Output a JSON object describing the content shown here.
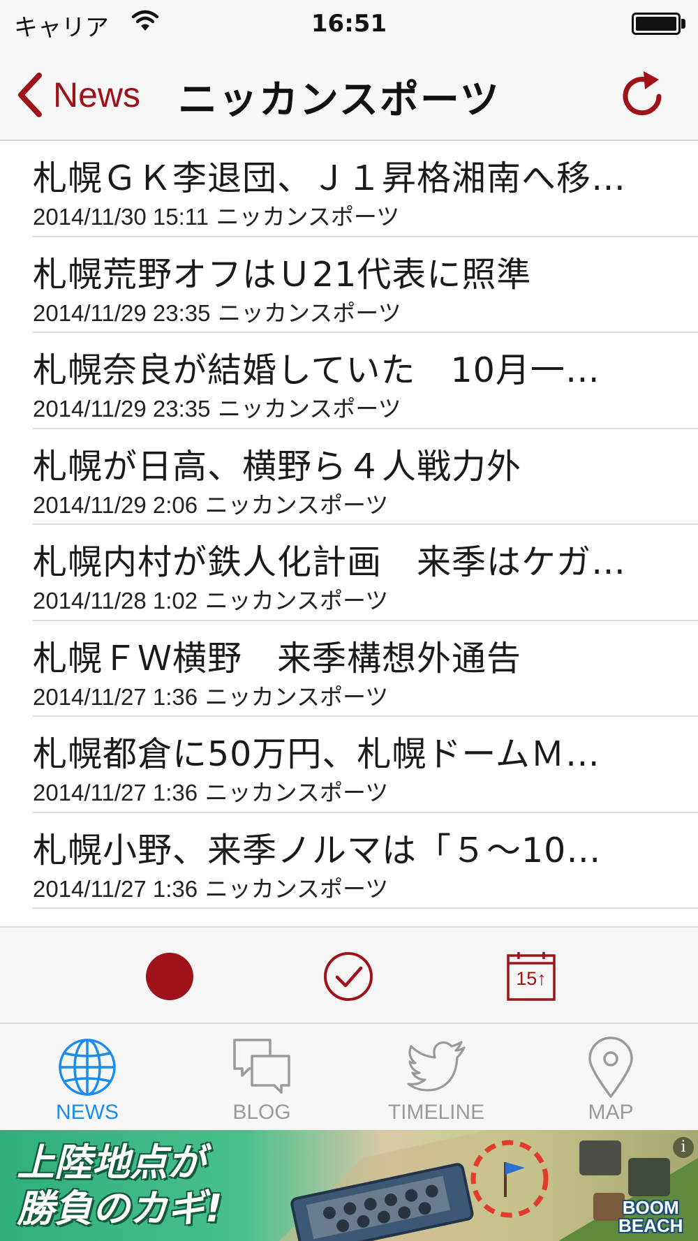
{
  "status_bar": {
    "carrier": "キャリア",
    "time": "16:51"
  },
  "nav": {
    "back_label": "News",
    "title": "ニッカンスポーツ"
  },
  "articles": [
    {
      "title": "札幌ＧＫ李退団、Ｊ１昇格湘南へ移…",
      "date": "2014/11/30 15:11",
      "source": "ニッカンスポーツ"
    },
    {
      "title": "札幌荒野オフはＵ21代表に照準",
      "date": "2014/11/29 23:35",
      "source": "ニッカンスポーツ"
    },
    {
      "title": "札幌奈良が結婚していた　10月一…",
      "date": "2014/11/29 23:35",
      "source": "ニッカンスポーツ"
    },
    {
      "title": "札幌が日高、横野ら４人戦力外",
      "date": "2014/11/29 2:06",
      "source": "ニッカンスポーツ"
    },
    {
      "title": "札幌内村が鉄人化計画　来季はケガ…",
      "date": "2014/11/28 1:02",
      "source": "ニッカンスポーツ"
    },
    {
      "title": "札幌ＦＷ横野　来季構想外通告",
      "date": "2014/11/27 1:36",
      "source": "ニッカンスポーツ"
    },
    {
      "title": "札幌都倉に50万円、札幌ドームＭ…",
      "date": "2014/11/27 1:36",
      "source": "ニッカンスポーツ"
    },
    {
      "title": "札幌小野、来季ノルマは「５～10…",
      "date": "2014/11/27 1:36",
      "source": "ニッカンスポーツ"
    }
  ],
  "toolbar": {
    "calendar_label": "15↑"
  },
  "tabs": [
    {
      "label": "NEWS",
      "icon": "globe-icon",
      "active": true
    },
    {
      "label": "BLOG",
      "icon": "chat-bubbles-icon",
      "active": false
    },
    {
      "label": "TIMELINE",
      "icon": "bird-icon",
      "active": false
    },
    {
      "label": "MAP",
      "icon": "map-pin-icon",
      "active": false
    }
  ],
  "ad": {
    "line1": "上陸地点が",
    "line2": "勝負のカギ!",
    "logo_line1": "BOOM",
    "logo_line2": "BEACH",
    "info": "i"
  },
  "colors": {
    "accent": "#a0121a",
    "tab_active": "#1a8cf0",
    "tab_inactive": "#9a9a9a"
  }
}
